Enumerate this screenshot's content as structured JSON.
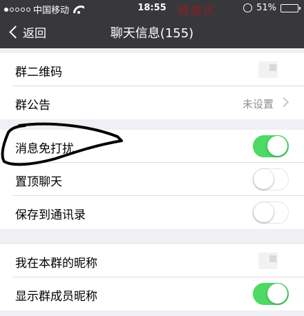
{
  "status_bar": {
    "carrier": "中国移动",
    "time": "18:55",
    "battery": "51%",
    "battery_level": 0.51,
    "watermark": "精感优"
  },
  "nav": {
    "back_label": "返回",
    "title": "聊天信息(155)"
  },
  "colors": {
    "nav_bg": "#38373c",
    "toggle_on": "#4cd964",
    "page_bg": "#efeff4"
  },
  "rows": {
    "qr": {
      "label": "群二维码"
    },
    "notice": {
      "label": "群公告",
      "value": "未设置"
    },
    "mute": {
      "label": "消息免打扰",
      "on": true
    },
    "pin": {
      "label": "置顶聊天",
      "on": false
    },
    "save": {
      "label": "保存到通讯录",
      "on": false
    },
    "nickname": {
      "label": "我在本群的昵称"
    },
    "show_names": {
      "label": "显示群成员昵称",
      "on": true
    }
  }
}
